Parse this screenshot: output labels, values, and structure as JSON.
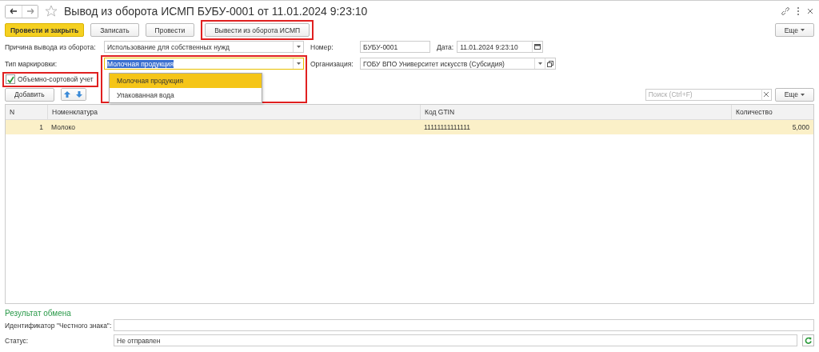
{
  "window": {
    "title": "Вывод из оборота ИСМП БУБУ-0001 от 11.01.2024 9:23:10",
    "favorite": false
  },
  "toolbar": {
    "buttons": [
      {
        "label": "Провести и закрыть",
        "kind": "primary"
      },
      {
        "label": "Записать",
        "kind": "normal"
      },
      {
        "label": "Провести",
        "kind": "normal"
      },
      {
        "label": "Вывести из оборота ИСМП",
        "kind": "normal"
      }
    ],
    "more": "Еще"
  },
  "form": {
    "reason_label": "Причина вывода из оборота:",
    "reason_value": "Использование для собственных нужд",
    "number_label": "Номер:",
    "number_value": "БУБУ-0001",
    "date_label": "Дата:",
    "date_value": "11.01.2024  9:23:10",
    "marking_label": "Тип маркировки:",
    "marking_value": "Молочная продукция",
    "org_label": "Организация:",
    "org_value": "ГОБУ ВПО Университет искусств (Субсидия)",
    "volume_label": "Объемно-сортовой учет",
    "volume_checked": true
  },
  "dropdown": {
    "expanded": true,
    "options": [
      {
        "label": "Молочная продукция",
        "selected": true
      },
      {
        "label": "Упакованная вода",
        "selected": false
      }
    ]
  },
  "table_toolbar": {
    "add": "Добавить",
    "search_placeholder": "Поиск (Ctrl+F)",
    "more": "Еще"
  },
  "table": {
    "columns": [
      "N",
      "Номенклатура",
      "Код GTIN",
      "Количество"
    ],
    "rows": [
      {
        "cells": [
          "1",
          "Молоко",
          "11111111111111",
          "5,000"
        ],
        "selected": true
      }
    ]
  },
  "result": {
    "heading": "Результат обмена",
    "id_label": "Идентификатор \"Честного знака\":",
    "status_label": "Статус:",
    "status_value": "Не отправлен"
  }
}
